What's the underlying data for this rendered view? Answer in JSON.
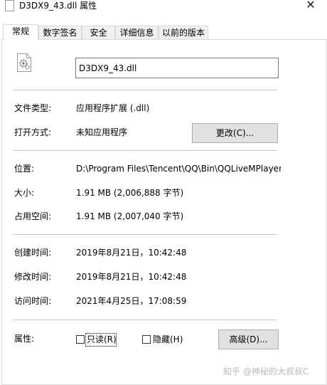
{
  "window": {
    "title": "D3DX9_43.dll 属性",
    "close_glyph": "✕"
  },
  "tabs": [
    {
      "label": "常规"
    },
    {
      "label": "数字签名"
    },
    {
      "label": "安全"
    },
    {
      "label": "详细信息"
    },
    {
      "label": "以前的版本"
    }
  ],
  "general": {
    "filename": "D3DX9_43.dll",
    "file_type_label": "文件类型:",
    "file_type_value": "应用程序扩展 (.dll)",
    "open_with_label": "打开方式:",
    "open_with_value": "未知应用程序",
    "change_button": "更改(C)...",
    "location_label": "位置:",
    "location_value": "D:\\Program Files\\Tencent\\QQ\\Bin\\QQLiveMPlayer",
    "size_label": "大小:",
    "size_value": "1.91 MB (2,006,888 字节)",
    "disk_size_label": "占用空间:",
    "disk_size_value": "1.91 MB (2,007,040 字节)",
    "created_label": "创建时间:",
    "created_value": "2019年8月21日，10:42:48",
    "modified_label": "修改时间:",
    "modified_value": "2019年8月21日，10:42:48",
    "accessed_label": "访问时间:",
    "accessed_value": "2021年4月25日，17:08:59",
    "attributes_label": "属性:",
    "readonly_label": "只读(R)",
    "hidden_label": "隐藏(H)",
    "advanced_button": "高级(D)..."
  },
  "watermark": "知乎 @神秘的大叔叔C",
  "colors": {
    "button_bg": "#e1e1e1",
    "tab_bg": "#f0f0f0",
    "border": "#d9d9d9"
  },
  "icons": {
    "title": "dll-file-icon",
    "file": "dll-gear-file-icon"
  }
}
